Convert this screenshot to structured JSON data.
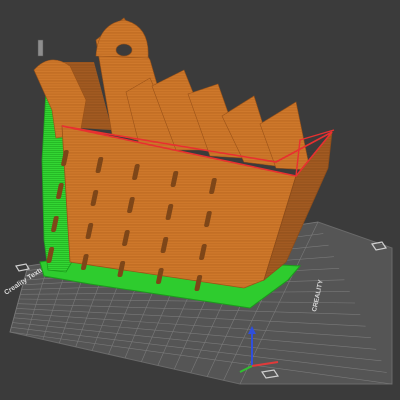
{
  "viewport": {
    "name": "3d-print-preview",
    "background": "#3b3b3b"
  },
  "bed": {
    "left_label": "Creality Texture",
    "right_label": "CREALITY",
    "plate_color": "#5a5a5a",
    "grid_color": "#7a7a7a"
  },
  "model": {
    "body_color": "#d07a2c",
    "support_color": "#2ecc2e",
    "outline_color": "#e83030"
  },
  "axes": {
    "x_color": "#e03a3a",
    "y_color": "#30c030",
    "z_color": "#2f4fdc"
  }
}
